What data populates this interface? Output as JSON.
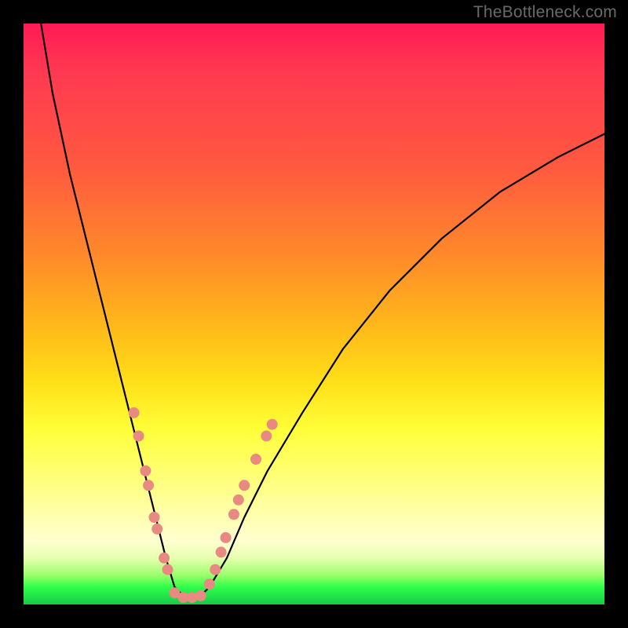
{
  "watermark": "TheBottleneck.com",
  "chart_data": {
    "type": "line",
    "title": "",
    "xlabel": "",
    "ylabel": "",
    "xlim": [
      0,
      100
    ],
    "ylim": [
      0,
      100
    ],
    "series": [
      {
        "name": "bottleneck-curve",
        "x": [
          3,
          5,
          8,
          11,
          14,
          17,
          19,
          21,
          23,
          24.5,
          26,
          28,
          30,
          32,
          35,
          38,
          42,
          48,
          55,
          63,
          72,
          82,
          92,
          100
        ],
        "y": [
          100,
          88,
          74,
          62,
          50,
          38,
          30,
          22,
          14,
          8,
          3,
          1,
          1,
          3,
          8,
          15,
          23,
          33,
          44,
          54,
          63,
          71,
          77,
          81
        ]
      }
    ],
    "markers": {
      "name": "highlight-dots",
      "color": "#e98a82",
      "points": [
        {
          "x": 19.0,
          "y": 33.0
        },
        {
          "x": 19.8,
          "y": 29.0
        },
        {
          "x": 21.0,
          "y": 23.0
        },
        {
          "x": 21.5,
          "y": 20.5
        },
        {
          "x": 22.5,
          "y": 15.0
        },
        {
          "x": 23.0,
          "y": 13.0
        },
        {
          "x": 24.2,
          "y": 8.0
        },
        {
          "x": 24.8,
          "y": 6.0
        },
        {
          "x": 26.0,
          "y": 2.0
        },
        {
          "x": 27.5,
          "y": 1.2
        },
        {
          "x": 29.0,
          "y": 1.2
        },
        {
          "x": 30.5,
          "y": 1.5
        },
        {
          "x": 32.0,
          "y": 3.5
        },
        {
          "x": 33.0,
          "y": 6.0
        },
        {
          "x": 34.0,
          "y": 9.0
        },
        {
          "x": 34.8,
          "y": 11.5
        },
        {
          "x": 36.2,
          "y": 15.5
        },
        {
          "x": 37.0,
          "y": 18.0
        },
        {
          "x": 38.0,
          "y": 20.5
        },
        {
          "x": 40.0,
          "y": 25.0
        },
        {
          "x": 41.8,
          "y": 29.0
        },
        {
          "x": 42.8,
          "y": 31.0
        }
      ]
    }
  }
}
